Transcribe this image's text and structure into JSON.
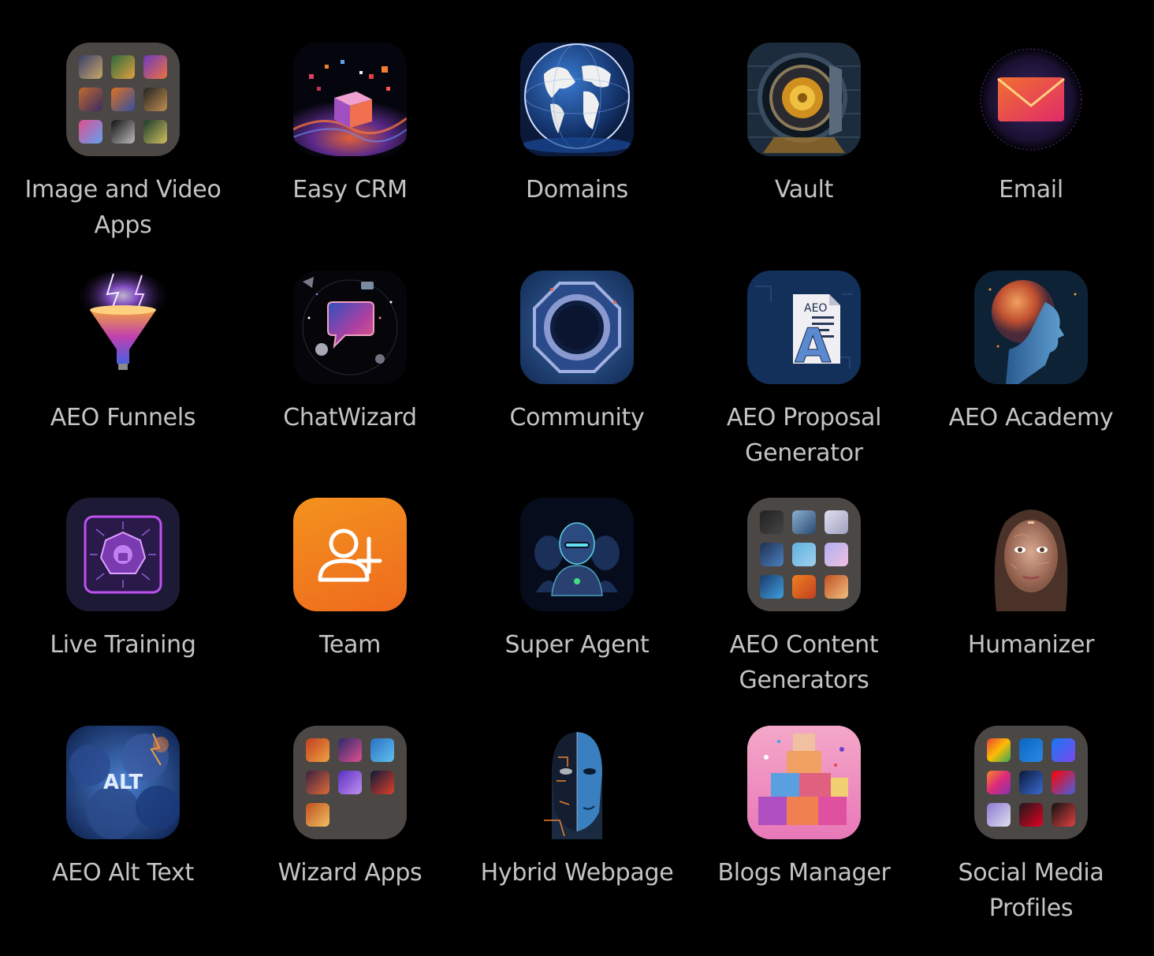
{
  "apps": [
    {
      "label": "Image and Video Apps",
      "icon": "image-video-folder-icon"
    },
    {
      "label": "Easy CRM",
      "icon": "cube-particles-icon"
    },
    {
      "label": "Domains",
      "icon": "globe-icon"
    },
    {
      "label": "Vault",
      "icon": "vault-door-icon"
    },
    {
      "label": "Email",
      "icon": "envelope-icon"
    },
    {
      "label": "AEO Funnels",
      "icon": "lightning-funnel-icon"
    },
    {
      "label": "ChatWizard",
      "icon": "chat-bubble-icon"
    },
    {
      "label": "Community",
      "icon": "octagon-ring-icon"
    },
    {
      "label": "AEO Proposal Generator",
      "icon": "aeo-document-icon",
      "icon_text": "AEO"
    },
    {
      "label": "AEO Academy",
      "icon": "head-profile-icon"
    },
    {
      "label": "Live Training",
      "icon": "circuit-chip-icon"
    },
    {
      "label": "Team",
      "icon": "add-user-icon"
    },
    {
      "label": "Super Agent",
      "icon": "robot-agents-icon"
    },
    {
      "label": "AEO Content Generators",
      "icon": "content-generators-folder-icon"
    },
    {
      "label": "Humanizer",
      "icon": "human-face-icon"
    },
    {
      "label": "AEO Alt Text",
      "icon": "alt-cloud-icon",
      "icon_text": "ALT"
    },
    {
      "label": "Wizard Apps",
      "icon": "wizard-apps-folder-icon"
    },
    {
      "label": "Hybrid Webpage",
      "icon": "hybrid-robot-face-icon"
    },
    {
      "label": "Blogs Manager",
      "icon": "colorful-blocks-icon"
    },
    {
      "label": "Social Media Profiles",
      "icon": "social-media-folder-icon"
    }
  ],
  "colors": {
    "background": "#000000",
    "label": "#c4c4c4",
    "team_orange": "#f0801d",
    "folder_gray": "#4a4744"
  }
}
